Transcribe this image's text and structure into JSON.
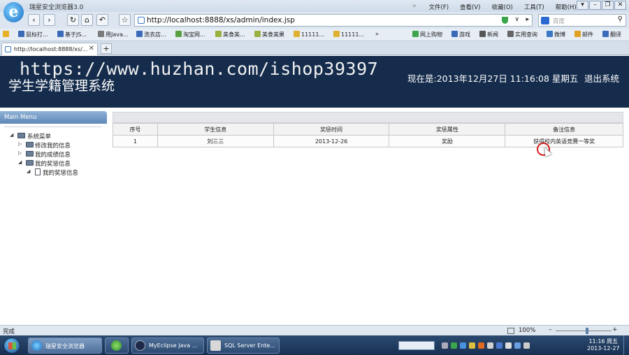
{
  "browser": {
    "title": "瑞星安全浏览器3.0",
    "logo_letter": "e",
    "menus": [
      "文件(F)",
      "查看(V)",
      "收藏(O)",
      "工具(T)",
      "帮助(H)"
    ],
    "menu_separator": "»",
    "address": "http://localhost:8888/xs/admin/index.jsp",
    "search_placeholder": "百度",
    "favorites": [
      "鼠标打...",
      "基于JS...",
      "用Java...",
      "洗衣店...",
      "淘宝网...",
      "美食美...",
      "美食美果",
      "11111...",
      "11111...",
      "»",
      "网上购物",
      "游戏",
      "新闻",
      "实用查询",
      "微博",
      "邮件",
      "翻译"
    ],
    "tab_label": "http://localhost:8888/xs/...",
    "tab_close": "✕",
    "new_tab": "+",
    "status_text": "完成",
    "zoom": "100%"
  },
  "page": {
    "watermark": "https://www.huzhan.com/ishop39397",
    "system_title": "学生学籍管理系统",
    "now_time": "现在是:2013年12月27日 11:16:08 星期五",
    "logout": "退出系统"
  },
  "menu": {
    "header": "Main Menu",
    "tree": [
      {
        "label": "系统菜单",
        "level": 0,
        "type": "folder",
        "expanded": true
      },
      {
        "label": "修改我的信息",
        "level": 1,
        "type": "folder",
        "expanded": false
      },
      {
        "label": "我的成绩信息",
        "level": 1,
        "type": "folder",
        "expanded": false
      },
      {
        "label": "我的奖惩信息",
        "level": 1,
        "type": "folder",
        "expanded": true
      },
      {
        "label": "我的奖惩信息",
        "level": 2,
        "type": "page",
        "expanded": false
      }
    ]
  },
  "table": {
    "headers": [
      "序号",
      "学生信息",
      "奖惩时间",
      "奖惩属性",
      "备注信息"
    ],
    "rows": [
      [
        "1",
        "刘三三",
        "2013-12-26",
        "奖励",
        "获得校内英语竞赛一等奖"
      ]
    ]
  },
  "taskbar": {
    "tasks": [
      "瑞星安全浏览器",
      "",
      "MyEclipse Java ...",
      "SQL Server Ente..."
    ],
    "clock_time": "11:16 周五",
    "clock_date": "2013-12-27"
  }
}
